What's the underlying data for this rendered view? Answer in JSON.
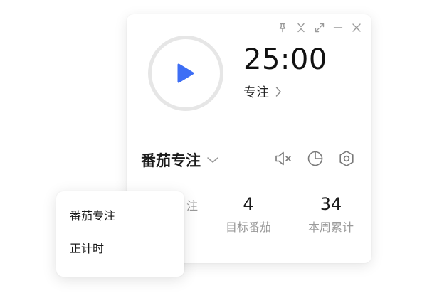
{
  "timer": {
    "time": "25:00",
    "mode_label": "专注"
  },
  "mode_selector": {
    "current": "番茄专注"
  },
  "stats": [
    {
      "value": "",
      "label": "注"
    },
    {
      "value": "4",
      "label": "目标番茄"
    },
    {
      "value": "34",
      "label": "本周累计"
    }
  ],
  "dropdown": {
    "items": [
      "番茄专注",
      "正计时"
    ]
  },
  "icons": {
    "play": "play-icon",
    "pin": "pin-icon",
    "collapse": "collapse-icon",
    "expand": "expand-icon",
    "minimize": "minimize-icon",
    "close": "close-icon",
    "mute": "mute-icon",
    "stats": "pie-chart-icon",
    "settings": "settings-icon"
  },
  "colors": {
    "accent": "#3d6ef5",
    "ring": "#e6e6e6",
    "icon": "#8a8a8a"
  }
}
